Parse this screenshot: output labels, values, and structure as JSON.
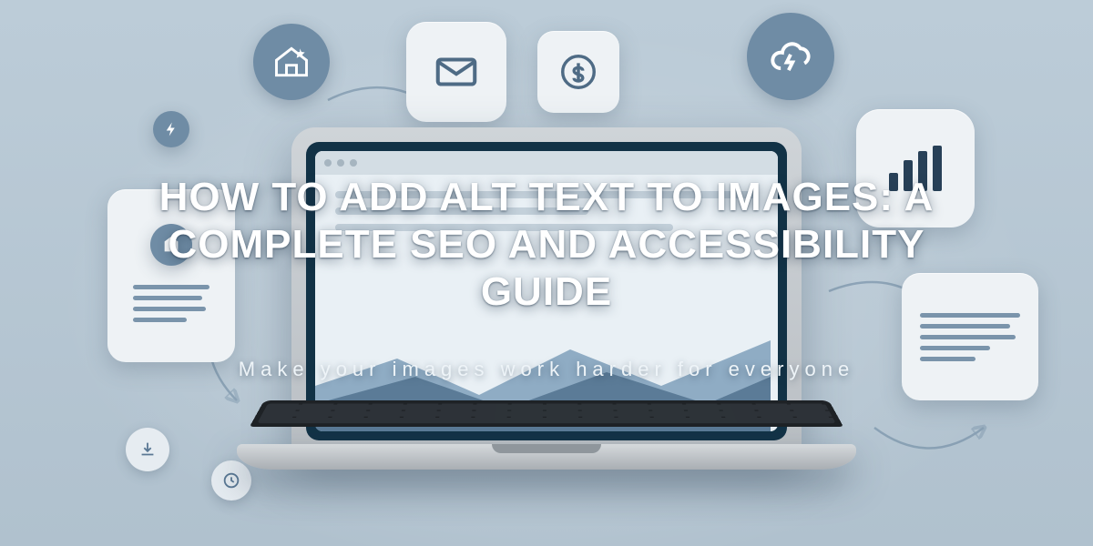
{
  "hero": {
    "title": "HOW TO ADD ALT TEXT TO IMAGES: A COMPLETE SEO AND ACCESSIBILITY GUIDE",
    "subtitle": "Make your images work harder for everyone"
  },
  "colors": {
    "background": "#b9c8d3",
    "tile": "#eef2f5",
    "accent": "#6f8ca5",
    "laptop_frame": "#cfd4d8",
    "laptop_screen_bezel": "#123246",
    "text_overlay": "#ffffff"
  },
  "icons": {
    "house": "house-star-icon",
    "envelope": "envelope-icon",
    "dollar": "dollar-coin-icon",
    "cloud": "cloud-bolt-icon",
    "bolt": "bolt-icon",
    "document_left": "document-icon",
    "barchart": "bar-chart-icon",
    "document_right": "document-lines-icon",
    "download": "download-icon",
    "clock": "clock-icon"
  }
}
